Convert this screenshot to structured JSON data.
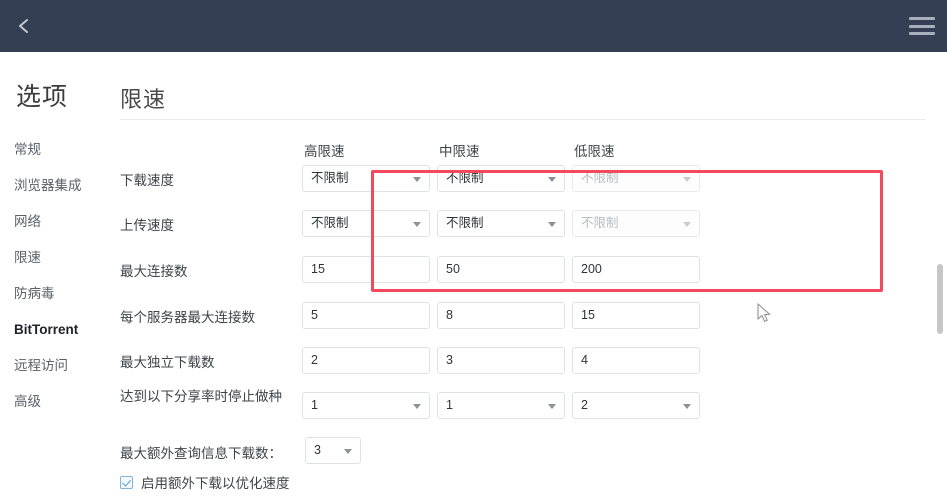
{
  "topbar": {
    "back_icon": "chevron-left-icon",
    "menu_icon": "hamburger-menu-icon",
    "background_color": "#343f53"
  },
  "sidebar": {
    "title": "选项",
    "items": [
      {
        "label": "常规",
        "active": false
      },
      {
        "label": "浏览器集成",
        "active": false
      },
      {
        "label": "网络",
        "active": false
      },
      {
        "label": "限速",
        "active": false
      },
      {
        "label": "防病毒",
        "active": false
      },
      {
        "label": "BitTorrent",
        "active": true
      },
      {
        "label": "远程访问",
        "active": false
      },
      {
        "label": "高级",
        "active": false
      }
    ]
  },
  "main": {
    "panel_title": "限速",
    "columns": [
      "高限速",
      "中限速",
      "低限速"
    ],
    "rows": [
      {
        "label": "下载速度",
        "type": "select",
        "values": [
          "不限制",
          "不限制",
          "不限制"
        ],
        "disabled": [
          false,
          false,
          true
        ]
      },
      {
        "label": "上传速度",
        "type": "select",
        "values": [
          "不限制",
          "不限制",
          "不限制"
        ],
        "disabled": [
          false,
          false,
          true
        ]
      },
      {
        "label": "最大连接数",
        "type": "text",
        "values": [
          "15",
          "50",
          "200"
        ],
        "disabled": [
          false,
          false,
          false
        ]
      },
      {
        "label": "每个服务器最大连接数",
        "type": "text",
        "values": [
          "5",
          "8",
          "15"
        ],
        "disabled": [
          false,
          false,
          false
        ]
      },
      {
        "label": "最大独立下载数",
        "type": "text",
        "values": [
          "2",
          "3",
          "4"
        ],
        "disabled": [
          false,
          false,
          false
        ]
      },
      {
        "label": "达到以下分享率时停止做种",
        "type": "select",
        "values": [
          "1",
          "1",
          "2"
        ],
        "disabled": [
          false,
          false,
          false
        ]
      }
    ],
    "extra_query": {
      "label": "最大额外查询信息下载数：",
      "value": "3"
    },
    "checkbox": {
      "label": "启用额外下载以优化速度",
      "checked": true
    },
    "highlight_color": "#f2495c"
  }
}
